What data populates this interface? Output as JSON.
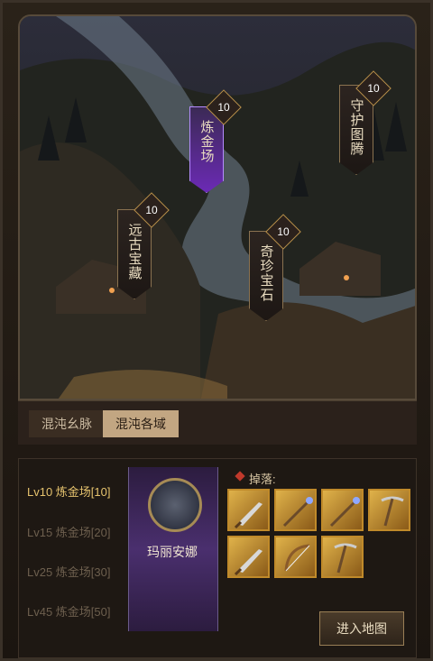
{
  "map_nodes": [
    {
      "label": "炼金场",
      "level": "10",
      "active": true
    },
    {
      "label": "守护图腾",
      "level": "10",
      "active": false
    },
    {
      "label": "远古宝藏",
      "level": "10",
      "active": false
    },
    {
      "label": "奇珍宝石",
      "level": "10",
      "active": false
    }
  ],
  "tabs": [
    {
      "label": "混沌幺脉",
      "selected": false
    },
    {
      "label": "混沌各域",
      "selected": true
    }
  ],
  "levels": [
    {
      "label": "Lv10 炼金场[10]",
      "active": true
    },
    {
      "label": "Lv15 炼金场[20]",
      "active": false
    },
    {
      "label": "Lv25 炼金场[30]",
      "active": false
    },
    {
      "label": "Lv45 炼金场[50]",
      "active": false
    }
  ],
  "boss": {
    "name": "玛丽安娜"
  },
  "drops": {
    "label": "掉落:",
    "items": [
      "sword-icon",
      "staff-icon",
      "staff-icon",
      "pickaxe-icon",
      "sword-icon",
      "bow-icon",
      "pickaxe-icon"
    ]
  },
  "enter_button": "进入地图",
  "colors": {
    "accent": "#e6c36e",
    "active_node": "#6b2ab5",
    "slot": "#e0b24a"
  }
}
